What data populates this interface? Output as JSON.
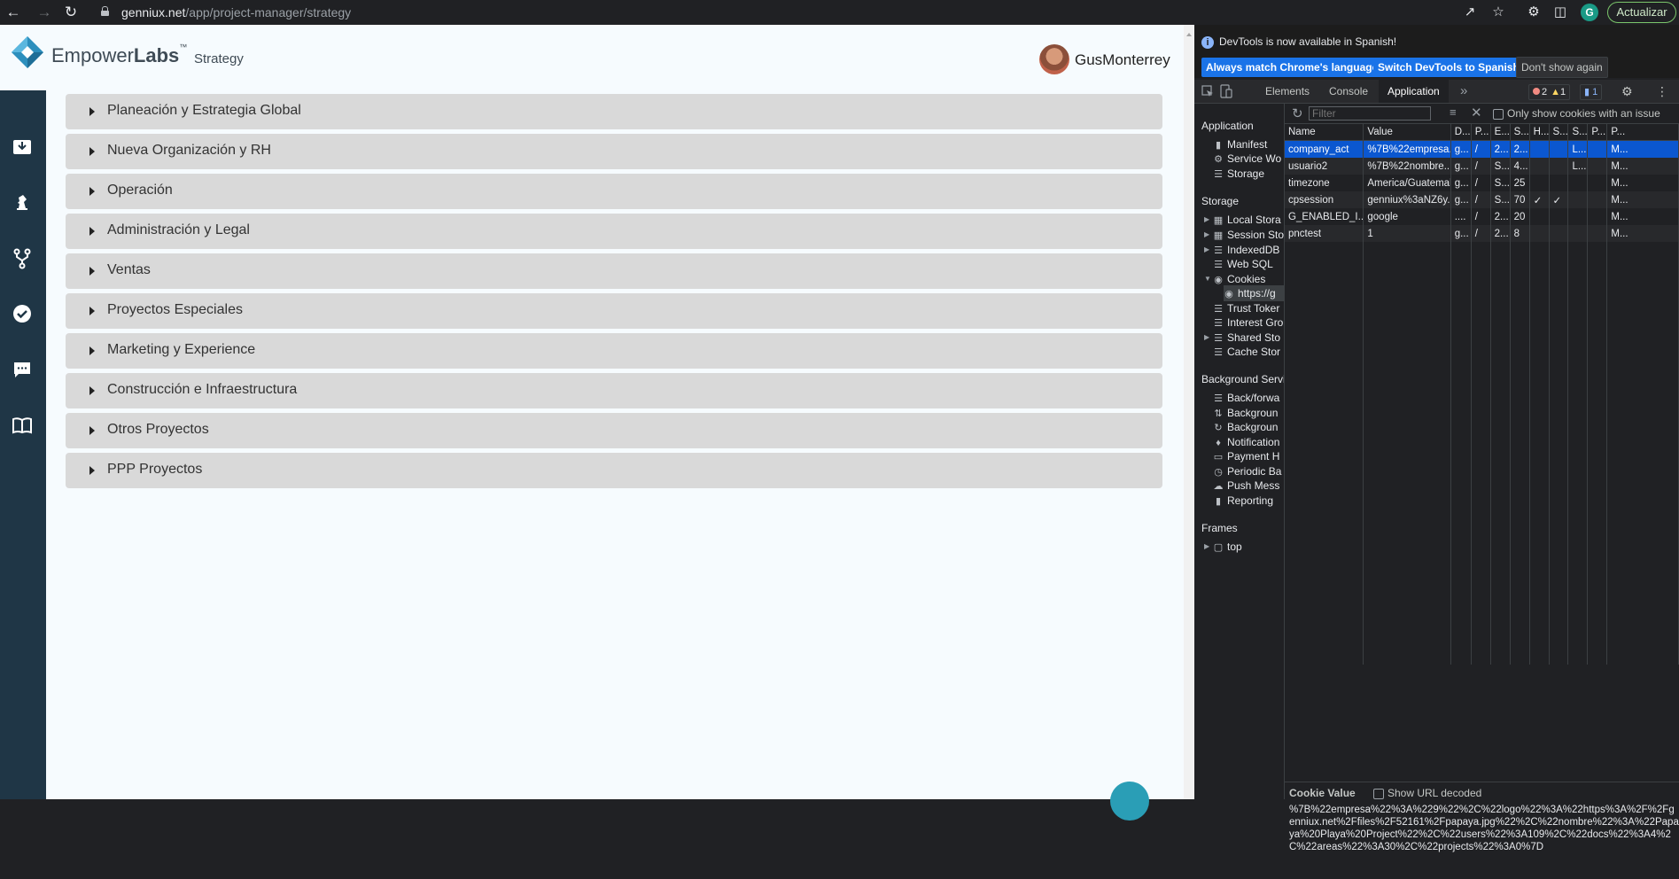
{
  "browser": {
    "url_host": "genniux.net",
    "url_path": "/app/project-manager/strategy",
    "profile_initial": "G",
    "update_button": "Actualizar"
  },
  "app": {
    "brand_empower": "Empower",
    "brand_labs": "Labs",
    "brand_tm": "™",
    "brand_sub": "Strategy",
    "user_name": "GusMonterrey",
    "nav_icons": [
      "inbox-icon",
      "chess-knight-icon",
      "branch-icon",
      "check-circle-icon",
      "chat-icon",
      "book-icon"
    ],
    "sections": [
      "Planeación y Estrategia Global",
      "Nueva Organización y RH",
      "Operación",
      "Administración y Legal",
      "Ventas",
      "Proyectos Especiales",
      "Marketing y Experience",
      "Construcción e Infraestructura",
      "Otros Proyectos",
      "PPP Proyectos"
    ]
  },
  "devtools": {
    "info_text": "DevTools is now available in Spanish!",
    "btn_match": "Always match Chrome's language",
    "btn_switch": "Switch DevTools to Spanish",
    "btn_dont_show": "Don't show again",
    "tabs": [
      "Elements",
      "Console",
      "Application"
    ],
    "active_tab": "Application",
    "more_tabs": "»",
    "errors": "2",
    "warnings": "1",
    "messages": "1",
    "sidebar": {
      "application_head": "Application",
      "application_items": [
        "Manifest",
        "Service Wo",
        "Storage"
      ],
      "storage_head": "Storage",
      "storage_items": [
        "Local Stora",
        "Session Sto",
        "IndexedDB",
        "Web SQL",
        "Cookies",
        "https://g",
        "Trust Toker",
        "Interest Gro",
        "Shared Sto",
        "Cache Stor"
      ],
      "bg_head": "Background Servi",
      "bg_items": [
        "Back/forwa",
        "Backgroun",
        "Backgroun",
        "Notification",
        "Payment H",
        "Periodic Ba",
        "Push Mess",
        "Reporting"
      ],
      "frames_head": "Frames",
      "frames_items": [
        "top"
      ]
    },
    "filter_placeholder": "Filter",
    "only_issue_label": "Only show cookies with an issue",
    "columns": [
      "Name",
      "Value",
      "D...",
      "P...",
      "E...",
      "S...",
      "H...",
      "S...",
      "S...",
      "P...",
      "P..."
    ],
    "rows": [
      [
        "company_act",
        "%7B%22empresa...",
        "g...",
        "/",
        "2...",
        "2...",
        "",
        "",
        "L...",
        "",
        "M..."
      ],
      [
        "usuario2",
        "%7B%22nombre...",
        "g...",
        "/",
        "S...",
        "4...",
        "",
        "",
        "L...",
        "",
        "M..."
      ],
      [
        "timezone",
        "America/Guatemala",
        "g...",
        "/",
        "S...",
        "25",
        "",
        "",
        "",
        "",
        "M..."
      ],
      [
        "cpsession",
        "genniux%3aNZ6y...",
        "g...",
        "/",
        "S...",
        "70",
        "✓",
        "✓",
        "",
        "",
        "M..."
      ],
      [
        "G_ENABLED_I...",
        "google",
        "....",
        "/",
        "2...",
        "20",
        "",
        "",
        "",
        "",
        "M..."
      ],
      [
        "pnctest",
        "1",
        "g...",
        "/",
        "2...",
        "8",
        "",
        "",
        "",
        "",
        "M..."
      ]
    ],
    "cookie_value_title": "Cookie Value",
    "show_url_decoded": "Show URL decoded",
    "cookie_value": "%7B%22empresa%22%3A%229%22%2C%22logo%22%3A%22https%3A%2F%2Fgenniux.net%2Ffiles%2F52161%2Fpapaya.jpg%22%2C%22nombre%22%3A%22Papaya%20Playa%20Project%22%2C%22users%22%3A109%2C%22docs%22%3A4%2C%22areas%22%3A30%2C%22projects%22%3A0%7D"
  }
}
